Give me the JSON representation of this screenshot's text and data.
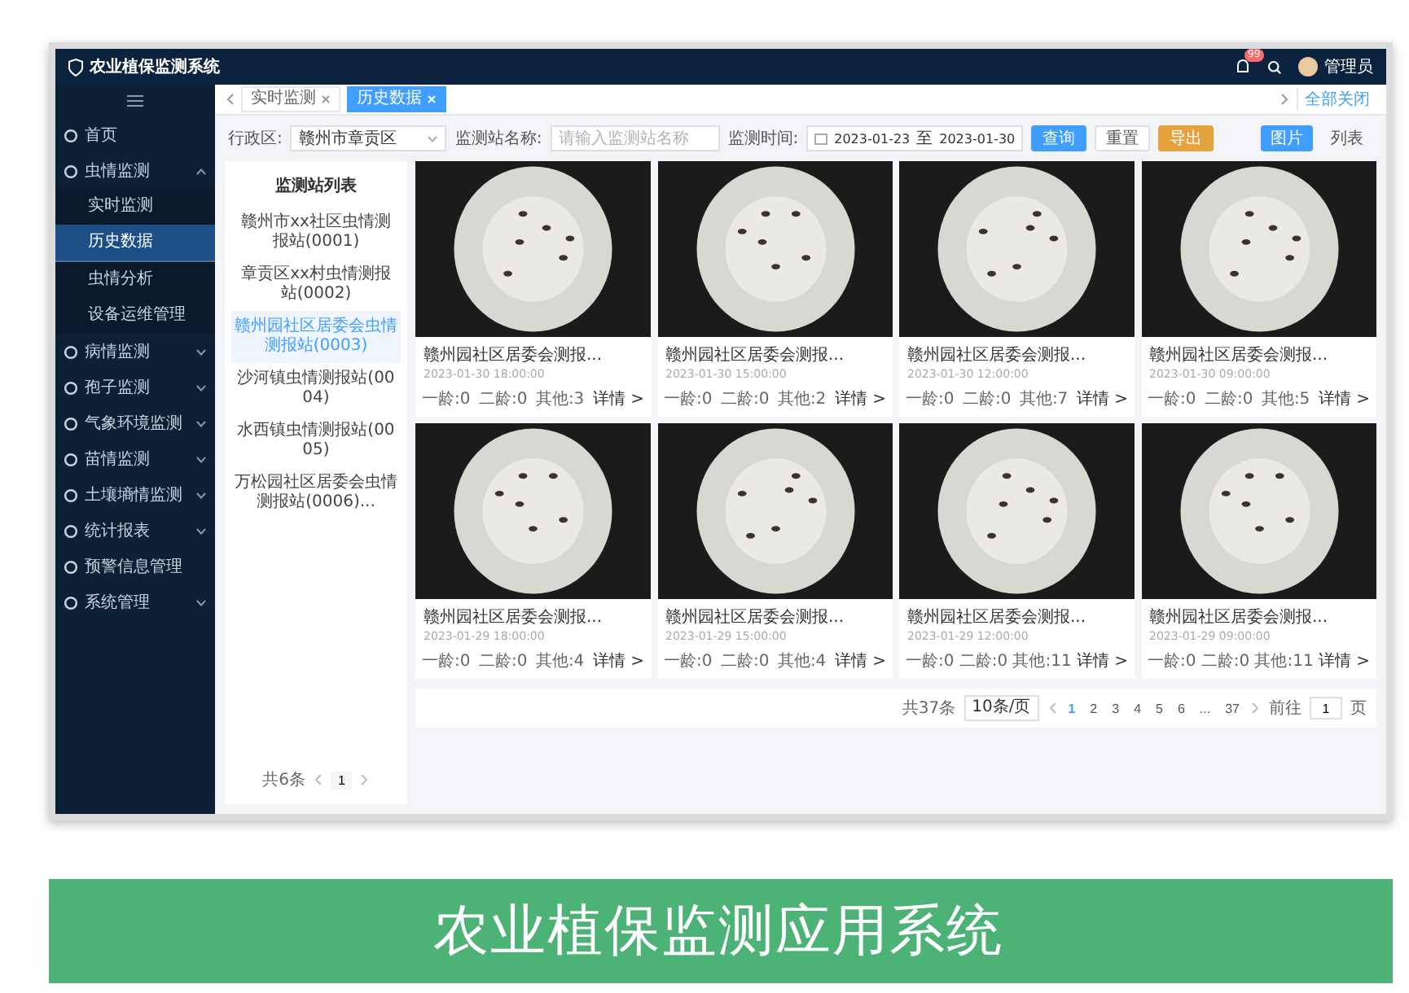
{
  "header": {
    "title": "农业植保监测系统",
    "badge": "99",
    "user": "管理员"
  },
  "sidebar": {
    "items": [
      {
        "label": "首页",
        "kind": "link",
        "selected": false
      },
      {
        "label": "虫情监测",
        "kind": "group",
        "expanded": true,
        "children": [
          {
            "label": "实时监测",
            "selected": false
          },
          {
            "label": "历史数据",
            "selected": true
          },
          {
            "label": "虫情分析",
            "selected": false
          },
          {
            "label": "设备运维管理",
            "selected": false
          }
        ]
      },
      {
        "label": "病情监测",
        "kind": "group",
        "expanded": false
      },
      {
        "label": "孢子监测",
        "kind": "group",
        "expanded": false
      },
      {
        "label": "气象环境监测",
        "kind": "group",
        "expanded": false
      },
      {
        "label": "苗情监测",
        "kind": "group",
        "expanded": false
      },
      {
        "label": "土壤墒情监测",
        "kind": "group",
        "expanded": false
      },
      {
        "label": "统计报表",
        "kind": "group",
        "expanded": false
      },
      {
        "label": "预警信息管理",
        "kind": "link",
        "selected": false
      },
      {
        "label": "系统管理",
        "kind": "group",
        "expanded": false
      }
    ]
  },
  "tabs": [
    {
      "label": "实时监测",
      "selected": false
    },
    {
      "label": "历史数据",
      "selected": true
    }
  ],
  "close_all": "全部关闭",
  "filters": {
    "region_label": "行政区:",
    "region_value": "赣州市章贡区",
    "station_label": "监测站名称:",
    "station_placeholder": "请输入监测站名称",
    "time_label": "监测时间:",
    "date_from": "2023-01-23",
    "date_sep": "至",
    "date_to": "2023-01-30",
    "buttons": [
      {
        "label": "查询",
        "kind": "primary"
      },
      {
        "label": "重置",
        "kind": "plain"
      },
      {
        "label": "导出",
        "kind": "warning"
      }
    ],
    "views": [
      {
        "label": "图片",
        "selected": true
      },
      {
        "label": "列表",
        "selected": false
      }
    ]
  },
  "station_list": {
    "title": "监测站列表",
    "items": [
      {
        "label": "赣州市xx社区虫情测报站(0001)",
        "selected": false
      },
      {
        "label": "章贡区xx村虫情测报站(0002)",
        "selected": false
      },
      {
        "label": "赣州园社区居委会虫情测报站(0003)",
        "selected": true
      },
      {
        "label": "沙河镇虫情测报站(0004)",
        "selected": false
      },
      {
        "label": "水西镇虫情测报站(0005)",
        "selected": false
      },
      {
        "label": "万松园社区居委会虫情测报站(0006)...",
        "selected": false
      }
    ],
    "total": "共6条",
    "page": "1"
  },
  "cards": [
    {
      "title": "赣州园社区居委会测报...",
      "time": "2023-01-30 18:00:00",
      "stage1": "一龄:0",
      "stage2": "二龄:0",
      "other": "其他:3",
      "link": "详情 >"
    },
    {
      "title": "赣州园社区居委会测报...",
      "time": "2023-01-30 15:00:00",
      "stage1": "一龄:0",
      "stage2": "二龄:0",
      "other": "其他:2",
      "link": "详情 >"
    },
    {
      "title": "赣州园社区居委会测报...",
      "time": "2023-01-30 12:00:00",
      "stage1": "一龄:0",
      "stage2": "二龄:0",
      "other": "其他:7",
      "link": "详情 >"
    },
    {
      "title": "赣州园社区居委会测报...",
      "time": "2023-01-30 09:00:00",
      "stage1": "一龄:0",
      "stage2": "二龄:0",
      "other": "其他:5",
      "link": "详情 >"
    },
    {
      "title": "赣州园社区居委会测报...",
      "time": "2023-01-29 18:00:00",
      "stage1": "一龄:0",
      "stage2": "二龄:0",
      "other": "其他:4",
      "link": "详情 >"
    },
    {
      "title": "赣州园社区居委会测报...",
      "time": "2023-01-29 15:00:00",
      "stage1": "一龄:0",
      "stage2": "二龄:0",
      "other": "其他:4",
      "link": "详情 >"
    },
    {
      "title": "赣州园社区居委会测报...",
      "time": "2023-01-29 12:00:00",
      "stage1": "一龄:0",
      "stage2": "二龄:0",
      "other": "其他:11",
      "link": "详情 >"
    },
    {
      "title": "赣州园社区居委会测报...",
      "time": "2023-01-29 09:00:00",
      "stage1": "一龄:0",
      "stage2": "二龄:0",
      "other": "其他:11",
      "link": "详情 >"
    }
  ],
  "pager": {
    "total": "共37条",
    "size": "10条/页",
    "pages": [
      {
        "label": "1",
        "selected": true
      },
      {
        "label": "2",
        "selected": false
      },
      {
        "label": "3",
        "selected": false
      },
      {
        "label": "4",
        "selected": false
      },
      {
        "label": "5",
        "selected": false
      },
      {
        "label": "6",
        "selected": false
      },
      {
        "label": "...",
        "selected": false
      },
      {
        "label": "37",
        "selected": false
      }
    ],
    "goto": "前往",
    "goto_value": "1",
    "unit": "页"
  },
  "caption": "农业植保监测应用系统"
}
